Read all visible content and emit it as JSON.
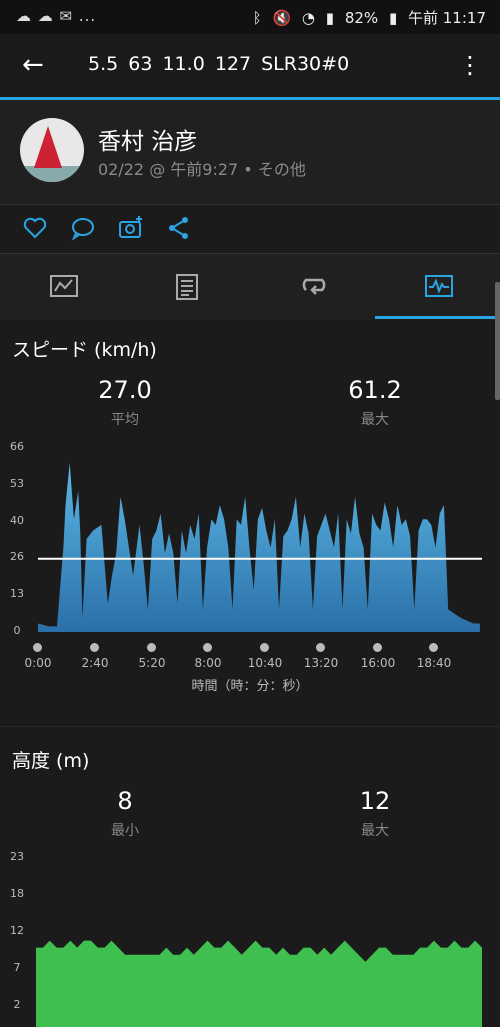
{
  "status": {
    "left_icons": "☁ ☁ ✉ ...",
    "battery": "82%",
    "time": "午前 11:17"
  },
  "appbar": {
    "title": "5.5  63  11.0  127  SLR30#0"
  },
  "profile": {
    "name": "香村 治彦",
    "meta": "02/22 @ 午前9:27 • その他"
  },
  "colors": {
    "accent": "#2aa3e3",
    "speed": "#2e8fc4",
    "elevation": "#3fbf4f"
  },
  "speed": {
    "title": "スピード (km/h)",
    "avg_value": "27.0",
    "avg_label": "平均",
    "max_value": "61.2",
    "max_label": "最大",
    "x_axis_label": "時間（時：分：秒）"
  },
  "elevation": {
    "title": "高度 (m)",
    "min_value": "8",
    "min_label": "最小",
    "max_value": "12",
    "max_label": "最大"
  },
  "chart_data": [
    {
      "type": "area",
      "name": "speed",
      "ylim": [
        0,
        66
      ],
      "yticks": [
        "0",
        "13",
        "26",
        "40",
        "53",
        "66"
      ],
      "xticks": [
        "0:00",
        "2:40",
        "5:20",
        "8:00",
        "10:40",
        "13:20",
        "16:00",
        "18:40"
      ],
      "average_line": 26,
      "x_minutes": [
        0,
        0.5,
        0.9,
        1.2,
        1.3,
        1.5,
        1.7,
        1.9,
        2.0,
        2.1,
        2.3,
        2.6,
        3.0,
        3.3,
        3.5,
        3.7,
        3.9,
        4.1,
        4.3,
        4.5,
        4.8,
        5.0,
        5.2,
        5.4,
        5.6,
        5.8,
        6.0,
        6.2,
        6.4,
        6.6,
        6.8,
        7.0,
        7.2,
        7.4,
        7.6,
        7.8,
        8.0,
        8.2,
        8.4,
        8.6,
        8.8,
        9.0,
        9.2,
        9.4,
        9.6,
        9.8,
        10.0,
        10.2,
        10.4,
        10.6,
        10.8,
        11.0,
        11.2,
        11.4,
        11.6,
        11.8,
        12.0,
        12.2,
        12.4,
        12.6,
        12.8,
        13.0,
        13.2,
        13.4,
        13.6,
        13.8,
        14.0,
        14.2,
        14.4,
        14.6,
        14.8,
        15.0,
        15.2,
        15.4,
        15.6,
        15.8,
        16.0,
        16.2,
        16.4,
        16.6,
        16.8,
        17.0,
        17.2,
        17.4,
        17.6,
        17.8,
        18.0,
        18.2,
        18.4,
        18.6,
        18.8,
        19.0,
        19.2,
        19.4,
        19.6,
        19.8,
        20.0,
        20.3,
        20.6,
        20.9
      ],
      "y_kmh": [
        3,
        2,
        2,
        30,
        45,
        60,
        40,
        50,
        35,
        5,
        33,
        36,
        38,
        10,
        20,
        28,
        48,
        40,
        30,
        20,
        38,
        24,
        8,
        33,
        36,
        42,
        28,
        35,
        28,
        10,
        36,
        28,
        38,
        33,
        42,
        8,
        30,
        40,
        38,
        45,
        40,
        30,
        8,
        40,
        38,
        48,
        30,
        15,
        40,
        44,
        36,
        30,
        40,
        8,
        34,
        36,
        40,
        48,
        30,
        42,
        35,
        8,
        34,
        38,
        42,
        36,
        30,
        42,
        8,
        40,
        35,
        48,
        35,
        30,
        8,
        42,
        38,
        36,
        46,
        40,
        30,
        45,
        38,
        40,
        34,
        8,
        36,
        40,
        40,
        38,
        30,
        42,
        45,
        8,
        7,
        6,
        5,
        4,
        3,
        3
      ]
    },
    {
      "type": "area",
      "name": "elevation",
      "ylim": [
        0,
        23
      ],
      "yticks": [
        "2",
        "7",
        "12",
        "18",
        "23"
      ],
      "y_m": [
        10,
        10,
        11,
        10,
        10,
        11,
        10,
        11,
        11,
        10,
        10,
        11,
        10,
        9,
        9,
        9,
        9,
        9,
        9,
        10,
        9,
        9,
        10,
        9,
        10,
        11,
        10,
        10,
        11,
        10,
        9,
        10,
        11,
        10,
        10,
        9,
        10,
        9,
        9,
        10,
        10,
        9,
        10,
        9,
        10,
        11,
        10,
        9,
        8,
        9,
        10,
        10,
        9,
        9,
        9,
        9,
        10,
        10,
        11,
        10,
        10,
        11,
        10,
        10,
        11,
        10
      ]
    }
  ]
}
